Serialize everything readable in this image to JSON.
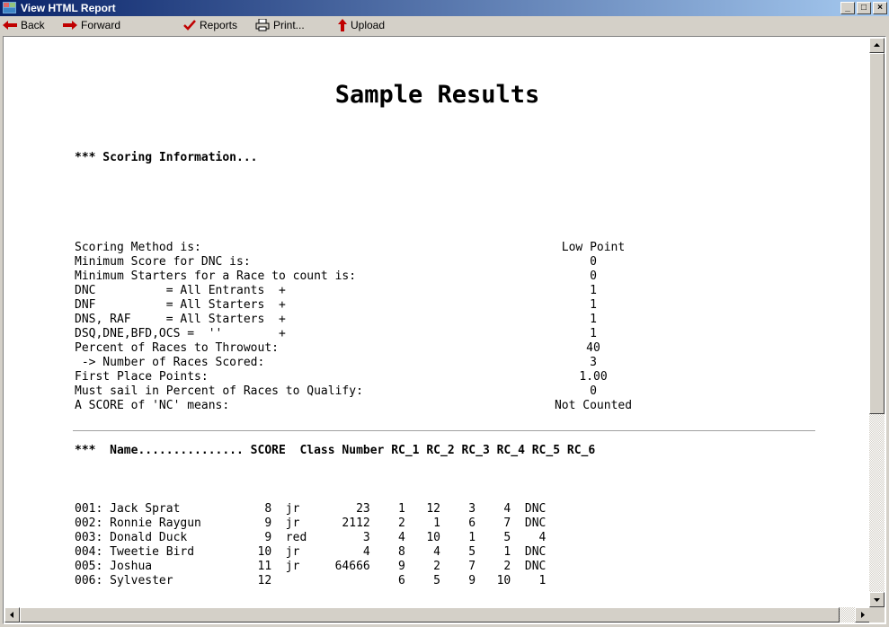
{
  "window": {
    "title": "View HTML Report"
  },
  "toolbar": {
    "back_label": "Back",
    "forward_label": "Forward",
    "reports_label": "Reports",
    "print_label": "Print...",
    "upload_label": "Upload"
  },
  "report": {
    "title": "Sample Results",
    "scoring_header": "*** Scoring Information...",
    "scoring": [
      {
        "label": "Scoring Method is:",
        "value": "Low Point"
      },
      {
        "label": "Minimum Score for DNC is:",
        "value": "0"
      },
      {
        "label": "Minimum Starters for a Race to count is:",
        "value": "0"
      },
      {
        "label": "DNC          = All Entrants  +",
        "value": "1"
      },
      {
        "label": "DNF          = All Starters  +",
        "value": "1"
      },
      {
        "label": "DNS, RAF     = All Starters  +",
        "value": "1"
      },
      {
        "label": "DSQ,DNE,BFD,OCS =  ''        +",
        "value": "1"
      },
      {
        "label": "Percent of Races to Throwout:",
        "value": "40"
      },
      {
        "label": " -> Number of Races Scored:",
        "value": "3"
      },
      {
        "label": "First Place Points:",
        "value": "1.00"
      },
      {
        "label": "Must sail in Percent of Races to Qualify:",
        "value": "0"
      },
      {
        "label": "A SCORE of 'NC' means:",
        "value": "Not Counted"
      }
    ],
    "results_header": "***  Name............... SCORE  Class Number RC_1 RC_2 RC_3 RC_4 RC_5 RC_6",
    "results": [
      "001: Jack Sprat            8  jr        23    1   12    3    4  DNC",
      "002: Ronnie Raygun         9  jr      2112    2    1    6    7  DNC",
      "003: Donald Duck           9  red        3    4   10    1    5    4",
      "004: Tweetie Bird         10  jr         4    8    4    5    1  DNC",
      "005: Joshua               11  jr     64666    9    2    7    2  DNC",
      "006: Sylvester            12                  6    5    9   10    1"
    ]
  }
}
